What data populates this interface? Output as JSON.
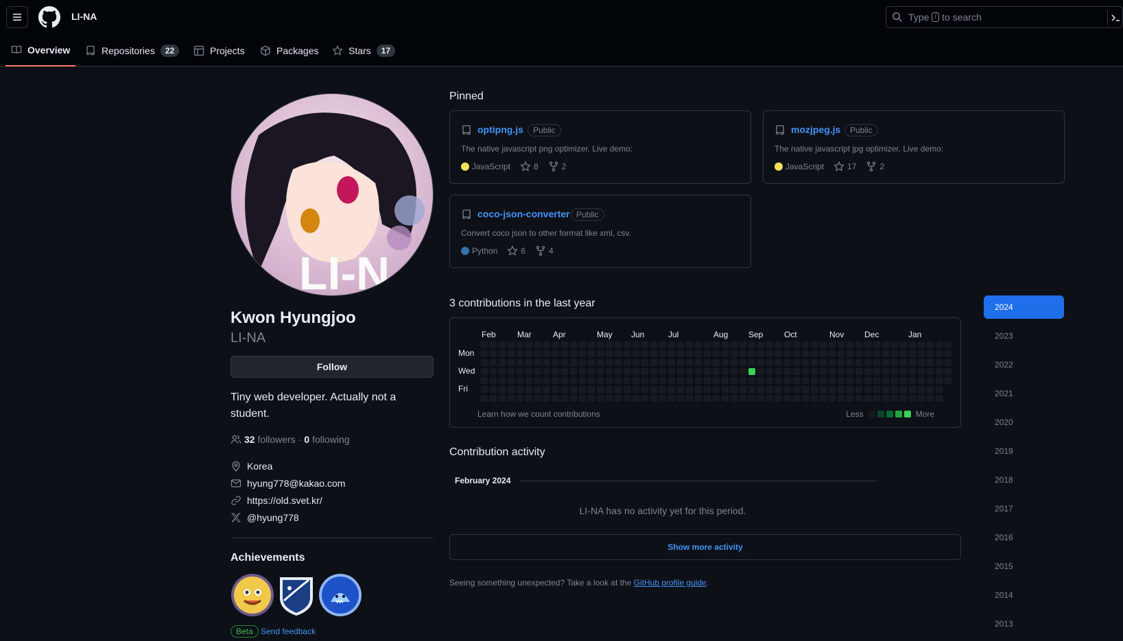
{
  "header": {
    "user_context": "LI-NA",
    "search_prefix": "Type",
    "search_key": "/",
    "search_suffix": "to search"
  },
  "tabs": [
    {
      "label": "Overview",
      "count": "",
      "icon": "book-icon",
      "active": true
    },
    {
      "label": "Repositories",
      "count": "22",
      "icon": "repo-icon"
    },
    {
      "label": "Projects",
      "count": "",
      "icon": "table-icon"
    },
    {
      "label": "Packages",
      "count": "",
      "icon": "package-icon"
    },
    {
      "label": "Stars",
      "count": "17",
      "icon": "star-icon"
    }
  ],
  "profile": {
    "avatar_text": "LI-N",
    "name": "Kwon Hyungjoo",
    "login": "LI-NA",
    "follow_label": "Follow",
    "bio": "Tiny web developer. Actually not a student.",
    "followers": "32",
    "followers_label": "followers",
    "following": "0",
    "following_label": "following",
    "separator": "·",
    "location": "Korea",
    "email": "hyung778@kakao.com",
    "website": "https://old.svet.kr/",
    "twitter": "@hyung778",
    "achievements_title": "Achievements",
    "beta_label": "Beta",
    "feedback_label": "Send feedback"
  },
  "pinned": {
    "title": "Pinned",
    "items": [
      {
        "name": "optipng.js",
        "visibility": "Public",
        "description": "The native javascript png optimizer. Live demo:",
        "language": "JavaScript",
        "lang_color": "#f1e05a",
        "stars": "8",
        "forks": "2"
      },
      {
        "name": "mozjpeg.js",
        "visibility": "Public",
        "description": "The native javascript jpg optimizer. Live demo:",
        "language": "JavaScript",
        "lang_color": "#f1e05a",
        "stars": "17",
        "forks": "2"
      },
      {
        "name": "coco-json-converter",
        "visibility": "Public",
        "description": "Convert coco json to other format like xml, csv.",
        "language": "Python",
        "lang_color": "#3572A5",
        "stars": "6",
        "forks": "4"
      }
    ]
  },
  "contributions": {
    "title": "3 contributions in the last year",
    "months": [
      "Feb",
      "Mar",
      "Apr",
      "May",
      "Jun",
      "Jul",
      "Aug",
      "Sep",
      "Oct",
      "Nov",
      "Dec",
      "Jan"
    ],
    "days": [
      "Mon",
      "Wed",
      "Fri"
    ],
    "weeks": 53,
    "active_cell": {
      "week": 30,
      "day": 3,
      "level": 4
    },
    "learn_label": "Learn how we count contributions",
    "less_label": "Less",
    "more_label": "More",
    "level_colors": [
      "#161b22",
      "#0e4429",
      "#006d32",
      "#26a641",
      "#39d353"
    ]
  },
  "years": [
    "2024",
    "2023",
    "2022",
    "2021",
    "2020",
    "2019",
    "2018",
    "2017",
    "2016",
    "2015",
    "2014",
    "2013"
  ],
  "activity": {
    "title": "Contribution activity",
    "month": "February 2024",
    "empty": "LI-NA has no activity yet for this period.",
    "show_more": "Show more activity",
    "guide_prefix": "Seeing something unexpected? Take a look at the",
    "guide_link": "GitHub profile guide",
    "guide_suffix": "."
  }
}
